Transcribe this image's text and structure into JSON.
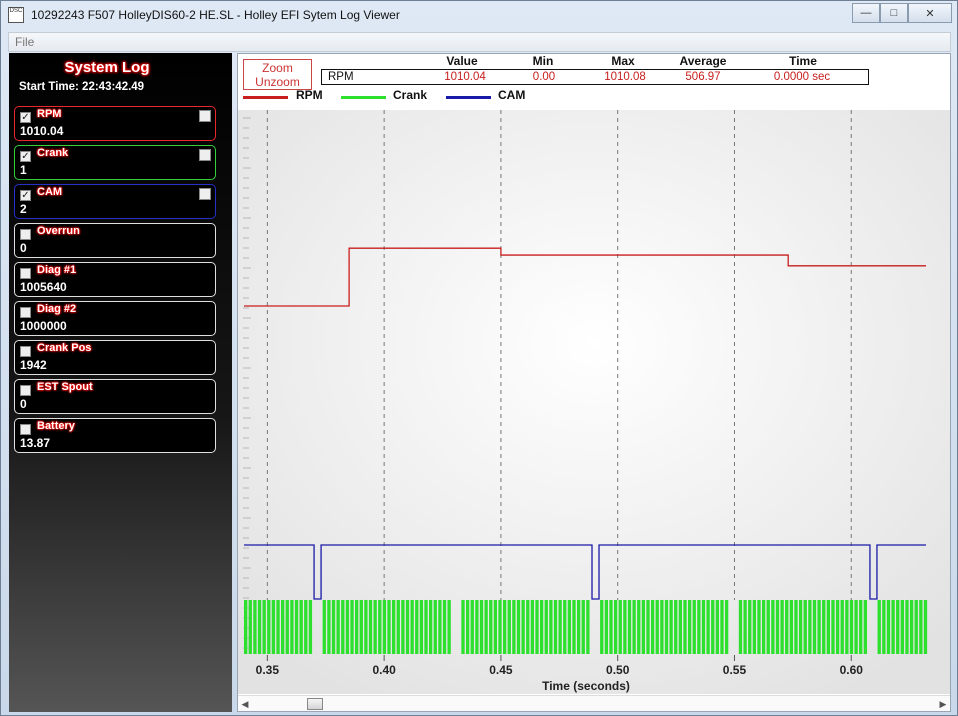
{
  "window": {
    "title": "10292243 F507 HolleyDIS60-2 HE.SL - Holley EFI Sytem Log Viewer",
    "app_icon_text": "DSC"
  },
  "menu": {
    "file": "File"
  },
  "sidebar": {
    "title": "System Log",
    "start_time": "Start Time: 22:43:42.49",
    "channels": [
      {
        "name": "RPM",
        "value": "1010.04",
        "checked": true,
        "border": "#e8282c"
      },
      {
        "name": "Crank",
        "value": "1",
        "checked": true,
        "border": "#33d13a"
      },
      {
        "name": "CAM",
        "value": "2",
        "checked": true,
        "border": "#2430c8"
      },
      {
        "name": "Overrun",
        "value": "0",
        "checked": false,
        "border": "#e0e0e0"
      },
      {
        "name": "Diag #1",
        "value": "1005640",
        "checked": false,
        "border": "#e0e0e0"
      },
      {
        "name": "Diag #2",
        "value": "1000000",
        "checked": false,
        "border": "#e0e0e0"
      },
      {
        "name": "Crank Pos",
        "value": "1942",
        "checked": false,
        "border": "#e0e0e0"
      },
      {
        "name": "EST Spout",
        "value": "0",
        "checked": false,
        "border": "#e0e0e0"
      },
      {
        "name": "Battery",
        "value": "13.87",
        "checked": false,
        "border": "#e0e0e0"
      }
    ]
  },
  "zoom": {
    "zoom_label": "Zoom",
    "unzoom_label": "Unzoom"
  },
  "stats": {
    "headers": {
      "value": "Value",
      "min": "Min",
      "max": "Max",
      "average": "Average",
      "time": "Time"
    },
    "row": {
      "channel": "RPM",
      "value": "1010.04",
      "min": "0.00",
      "max": "1010.08",
      "average": "506.97",
      "time": "0.0000 sec"
    }
  },
  "legend": [
    {
      "name": "RPM",
      "color": "#c81e1e"
    },
    {
      "name": "Crank",
      "color": "#2ee02e"
    },
    {
      "name": "CAM",
      "color": "#1a1aa8"
    }
  ],
  "chart_data": {
    "type": "line",
    "xlabel": "Time (seconds)",
    "xlim": [
      0.34,
      0.632
    ],
    "x_ticks": [
      0.35,
      0.4,
      0.45,
      0.5,
      0.55,
      0.6
    ],
    "x_tick_labels": [
      "0.35",
      "0.40",
      "0.45",
      "0.50",
      "0.55",
      "0.60"
    ],
    "grid": "vertical dashed",
    "series": [
      {
        "name": "RPM",
        "color": "#c81e1e",
        "steps": [
          [
            0.34,
            0.6
          ],
          [
            0.385,
            0.718
          ],
          [
            0.45,
            0.704
          ],
          [
            0.573,
            0.682
          ],
          [
            0.632,
            0.682
          ]
        ]
      },
      {
        "name": "CAM",
        "color": "#1a1aa8",
        "high_intervals": [
          [
            0.34,
            0.37
          ],
          [
            0.373,
            0.489
          ],
          [
            0.492,
            0.608
          ],
          [
            0.611,
            0.632
          ]
        ]
      },
      {
        "name": "Crank",
        "color": "#2ee02e",
        "missing_tooth_gaps": [
          0.371,
          0.43,
          0.49,
          0.549,
          0.609
        ],
        "pulse_period": 0.00198
      }
    ]
  }
}
